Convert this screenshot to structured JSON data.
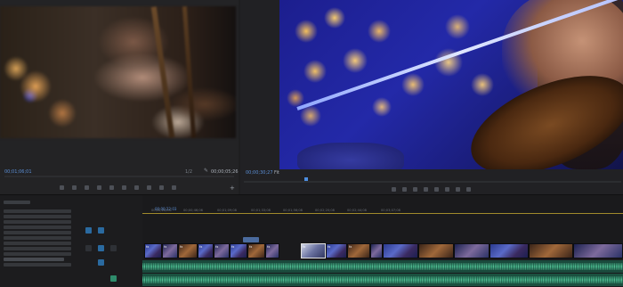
{
  "source_monitor": {
    "timecode": "00;01;06;01",
    "fraction": "1/2",
    "duration": "00;00;05;26",
    "add_label": "+"
  },
  "program_monitor": {
    "timecode": "00;00;30;27",
    "fit": "Fit"
  },
  "timeline": {
    "sequence_timecode": "00;00;22;03",
    "ruler_ticks": [
      "00;00;22;03",
      "00;00;46;06",
      "00;01;09;08",
      "00;01;33;08",
      "00;01;56;08",
      "00;02;20;08",
      "00;02;44;08",
      "00;03;07;08",
      "00;03;31;08",
      "00;03;54;08"
    ]
  },
  "colors": {
    "accent_blue": "#5b8fd6",
    "audio_green": "#55d8a2",
    "playhead_gold": "#a08a2c",
    "panel_bg": "#1e1e20"
  },
  "icons": [
    "wrench-icon",
    "plus-icon",
    "play-icon",
    "step-forward-icon",
    "step-back-icon",
    "marker-icon",
    "export-frame-icon"
  ]
}
